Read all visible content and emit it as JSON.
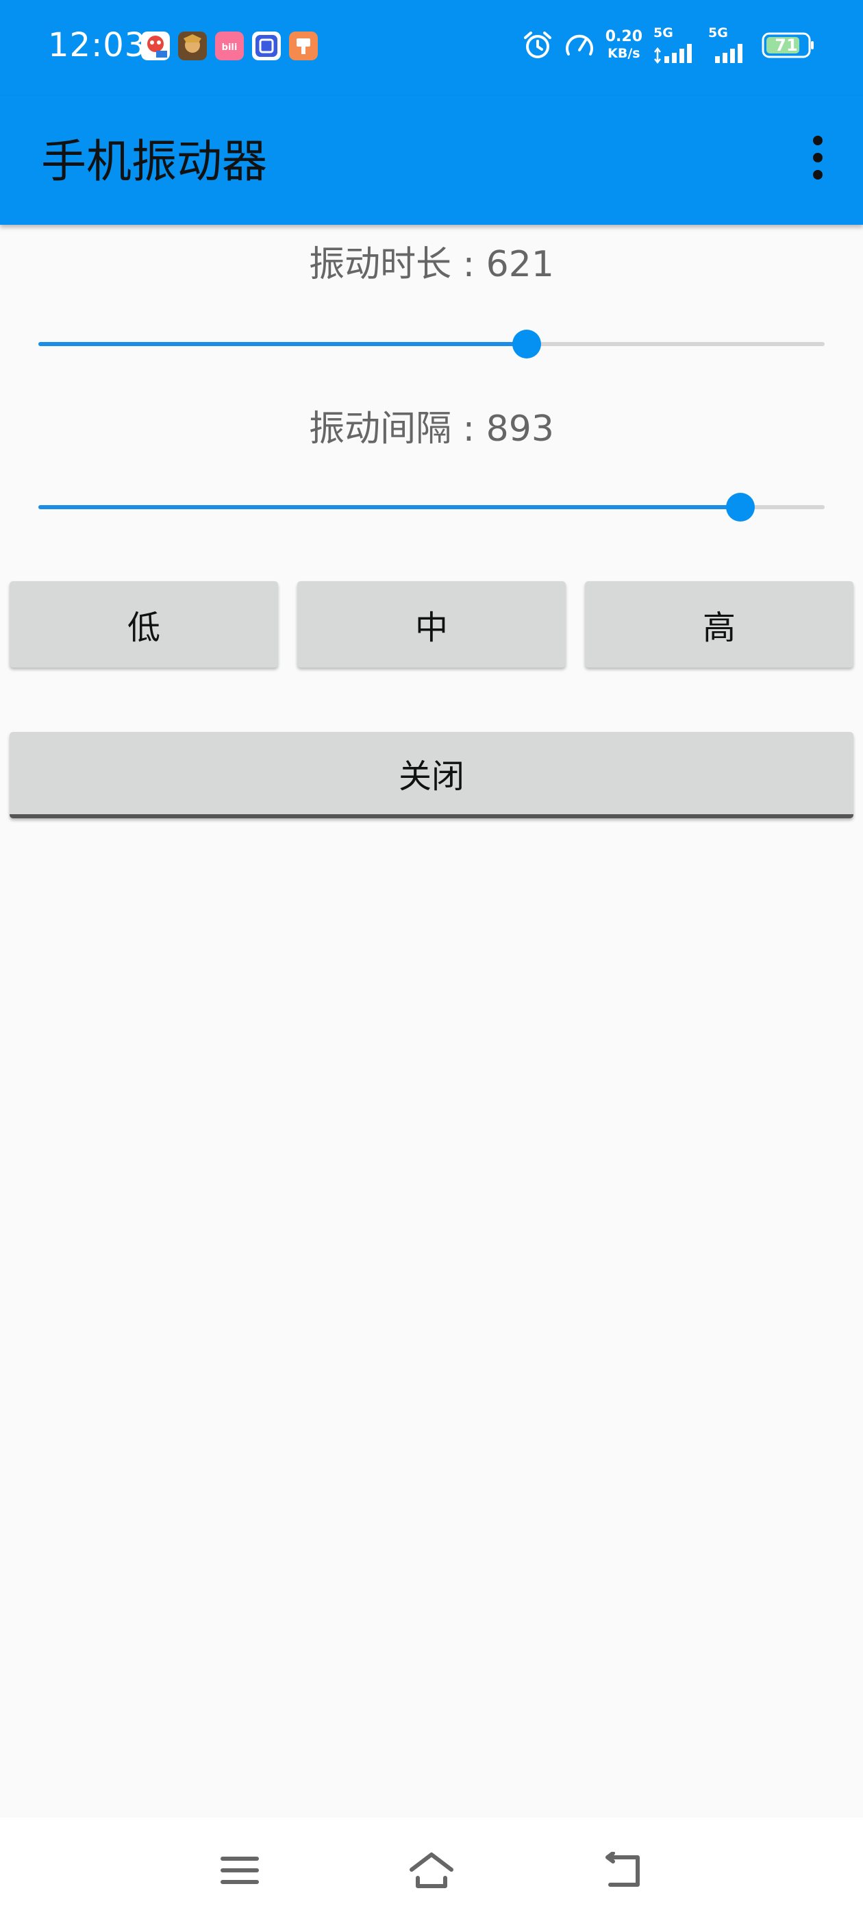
{
  "status_bar": {
    "time": "12:03",
    "notification_icons": [
      {
        "name": "game-app-icon",
        "color": "#e8453c"
      },
      {
        "name": "hero-game-icon",
        "color": "#b5762a"
      },
      {
        "name": "bilibili-icon",
        "color": "#fb7299"
      },
      {
        "name": "tieba-icon",
        "color": "#3a5be0"
      },
      {
        "name": "orange-app-icon",
        "color": "#f58a4e"
      }
    ],
    "speed_value": "0.20",
    "speed_unit": "KB/s",
    "signal_1_label": "5G",
    "signal_2_label": "5G",
    "battery": "71"
  },
  "app_bar": {
    "title": "手机振动器"
  },
  "duration_slider": {
    "label": "振动时长 : 621",
    "value": 621,
    "fraction": 0.621
  },
  "interval_slider": {
    "label": "振动间隔 : 893",
    "value": 893,
    "fraction": 0.893
  },
  "presets": {
    "low": "低",
    "mid": "中",
    "high": "高"
  },
  "close_label": "关闭",
  "colors": {
    "primary": "#0591f2",
    "track": "#1a8ee6",
    "background": "#fafafa",
    "button": "#d7d8d8"
  }
}
